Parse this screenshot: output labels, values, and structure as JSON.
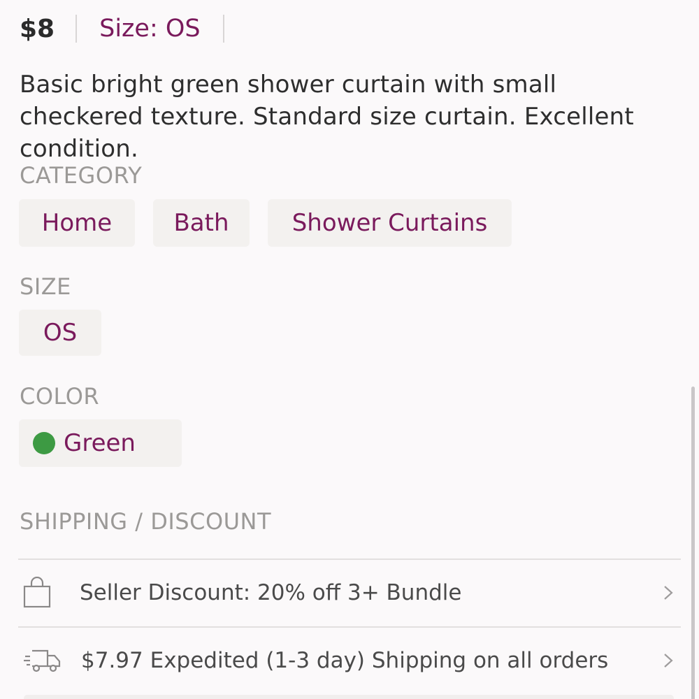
{
  "listing": {
    "price": "$8",
    "size_label": "Size: OS",
    "description": "Basic bright green shower curtain with small checkered texture. Standard size curtain. Excellent condition."
  },
  "category": {
    "heading": "CATEGORY",
    "chips": [
      "Home",
      "Bath",
      "Shower Curtains"
    ]
  },
  "size": {
    "heading": "SIZE",
    "value": "OS"
  },
  "color": {
    "heading": "COLOR",
    "value": "Green",
    "swatch": "#3d9a43"
  },
  "shipping": {
    "heading": "SHIPPING / DISCOUNT",
    "rows": [
      {
        "icon": "shopping-bag-icon",
        "text": "Seller Discount: 20% off 3+ Bundle"
      },
      {
        "icon": "delivery-truck-icon",
        "text": "$7.97 Expedited (1-3 day) Shipping on all orders"
      }
    ]
  },
  "colors": {
    "accent": "#7a1a5c",
    "heading_gray": "#9b9997",
    "chip_bg": "#f3f1ef",
    "background": "#fbf9fa"
  }
}
